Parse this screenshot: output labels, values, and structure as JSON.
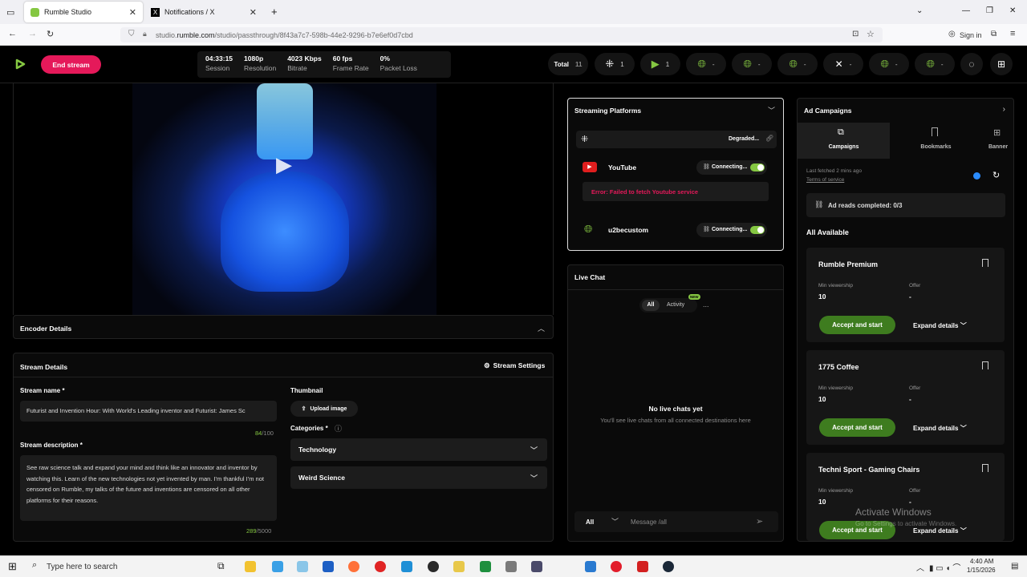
{
  "browser": {
    "tabs": [
      {
        "title": "Rumble Studio",
        "active": true
      },
      {
        "title": "Notifications / X",
        "active": false
      }
    ],
    "url_prefix": "studio.",
    "url_domain": "rumble.com",
    "url_path": "/studio/passthrough/8f43a7c7-598b-44e2-9296-b7e6ef0d7cbd",
    "sign_in": "Sign in"
  },
  "topbar": {
    "end_stream": "End stream",
    "stats": [
      {
        "value": "04:33:15",
        "label": "Session"
      },
      {
        "value": "1080p",
        "label": "Resolution"
      },
      {
        "value": "4023 Kbps",
        "label": "Bitrate"
      },
      {
        "value": "60 fps",
        "label": "Frame Rate"
      },
      {
        "value": "0%",
        "label": "Packet Loss"
      }
    ],
    "total_label": "Total",
    "total_count": "11",
    "pill_counts": [
      "1",
      "1",
      "-",
      "-",
      "-",
      "-",
      "-",
      "-"
    ]
  },
  "encoder": {
    "title": "Encoder Details"
  },
  "stream_details": {
    "title": "Stream Details",
    "settings": "Stream Settings",
    "name_label": "Stream name *",
    "name_value": "Futurist and Invention Hour: With World's Leading inventor and Futurist: James Sc",
    "name_count": "84",
    "name_max": "/100",
    "desc_label": "Stream description *",
    "desc_value": "See raw science talk and expand your mind and think like an innovator and inventor by watching this. Learn of the new technologies not yet invented by man. I'm thankful I'm not censored on Rumble, my talks of the future and inventions are censored on all other platforms for their reasons.",
    "desc_count": "289",
    "desc_max": "/5000",
    "thumb_label": "Thumbnail",
    "upload": "Upload image",
    "categories_label": "Categories *",
    "categories": [
      "Technology",
      "Weird Science"
    ]
  },
  "platforms": {
    "title": "Streaming Platforms",
    "rows": [
      {
        "name": "",
        "status": "Degraded..."
      },
      {
        "name": "YouTube",
        "status": "Connecting..."
      },
      {
        "name": "u2becustom",
        "status": "Connecting..."
      }
    ],
    "error": "Error: Failed to fetch Youtube service"
  },
  "chat": {
    "title": "Live Chat",
    "tab_all": "All",
    "tab_activity": "Activity",
    "new_badge": "NEW",
    "more": "...",
    "empty_title": "No live chats yet",
    "empty_sub": "You'll see live chats from all connected destinations here",
    "filter": "All",
    "placeholder": "Message /all"
  },
  "ads": {
    "title": "Ad Campaigns",
    "tabs": [
      "Campaigns",
      "Bookmarks",
      "Banner"
    ],
    "fetched": "Last fetched 2 mins ago",
    "terms": "Terms of service",
    "ad_reads": "Ad reads completed: 0/3",
    "all_available": "All Available",
    "min_label": "Min viewership",
    "offer_label": "Offer",
    "accept": "Accept and start",
    "expand": "Expand details",
    "cards": [
      {
        "title": "Rumble Premium",
        "min": "10",
        "offer": "-"
      },
      {
        "title": "1775 Coffee",
        "min": "10",
        "offer": "-"
      },
      {
        "title": "Techni Sport - Gaming Chairs",
        "min": "10",
        "offer": "-"
      }
    ]
  },
  "watermark": {
    "line1": "Activate Windows",
    "line2": "Go to Settings to activate Windows."
  },
  "taskbar": {
    "search": "Type here to search",
    "time": "4:40 AM",
    "date": "1/15/2026"
  },
  "colors": {
    "brand_green": "#85c742",
    "end_red": "#e5195a",
    "error_red": "#e5195a",
    "accept_green": "#3e7c1f"
  }
}
